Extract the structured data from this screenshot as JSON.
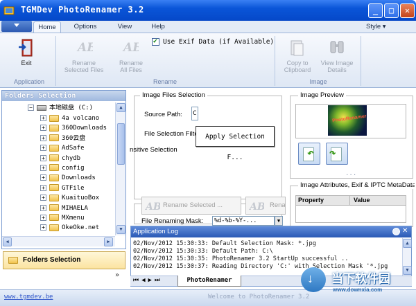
{
  "window": {
    "title": "TGMDev PhotoRenamer 3.2",
    "buttons": {
      "minimize": "_",
      "maximize": "□",
      "close": "✕"
    }
  },
  "ribbon": {
    "tabs": [
      "Home",
      "Options",
      "View",
      "Help"
    ],
    "active_tab": "Home",
    "style_menu": "Style ▾",
    "groups": {
      "application": {
        "label": "Application",
        "exit": "Exit"
      },
      "rename": {
        "label": "Rename",
        "rename_selected": [
          "Rename",
          "Selected Files"
        ],
        "rename_all": [
          "Rename",
          "All Files"
        ],
        "use_exif": "Use Exif Data (if Available)",
        "use_exif_checked": true
      },
      "image": {
        "label": "Image",
        "copy": [
          "Copy to",
          "Clipboard"
        ],
        "view_details": [
          "View Image",
          "Details"
        ]
      }
    }
  },
  "folders": {
    "header": "Folders Selection",
    "drive": "本地磁盘 (C:)",
    "items": [
      "4a volcano",
      "360Downloads",
      "360云盘",
      "AdSafe",
      "chydb",
      "config",
      "Downloads",
      "GTFile",
      "KuaituoBox",
      "MIHAELA",
      "MXmenu",
      "OkeOke.net"
    ],
    "bottom_tab": "Folders Selection"
  },
  "image_files": {
    "legend": "Image Files Selection",
    "source_path_label": "Source Path:",
    "source_path_value": "C",
    "file_filter_label": "File Selection Filter",
    "case_label": "nsitive Selection",
    "apply_button": "Apply Selection F..."
  },
  "rename_panel": {
    "rename_selected": "Rename Selected ...",
    "rename_all": "Rena",
    "mask_label": "File Renaming Mask:",
    "mask_value": "%d-%b-%Y-..."
  },
  "log": {
    "header": "Application Log",
    "lines": [
      "02/Nov/2012 15:30:33: Default Selection Mask: *.jpg",
      "02/Nov/2012 15:30:33: Default Path: C:\\",
      "02/Nov/2012 15:30:35: PhotoRenamer 3.2 StartUp successful ..",
      "02/Nov/2012 15:30:37: Reading Directory 'C:' with Selection Mask '*.jpg"
    ],
    "tab": "PhotoRenamer"
  },
  "right": {
    "preview_legend": "Image Preview",
    "preview_caption": "PhotoRenamer",
    "attributes_legend": "Image Attributes, Exif & IPTC MetaData",
    "columns": [
      "Property",
      "Value"
    ],
    "dots": "..."
  },
  "status": {
    "link": "www.tgmdev.be",
    "message": "Welcome to PhotoRenamer 3.2"
  },
  "watermark": {
    "text": "当下软件园",
    "url": "www.downxia.com"
  },
  "colors": {
    "titlebar": "#0a55d8",
    "ribbon": "#dee7f4",
    "log_header": "#2a59b5"
  }
}
